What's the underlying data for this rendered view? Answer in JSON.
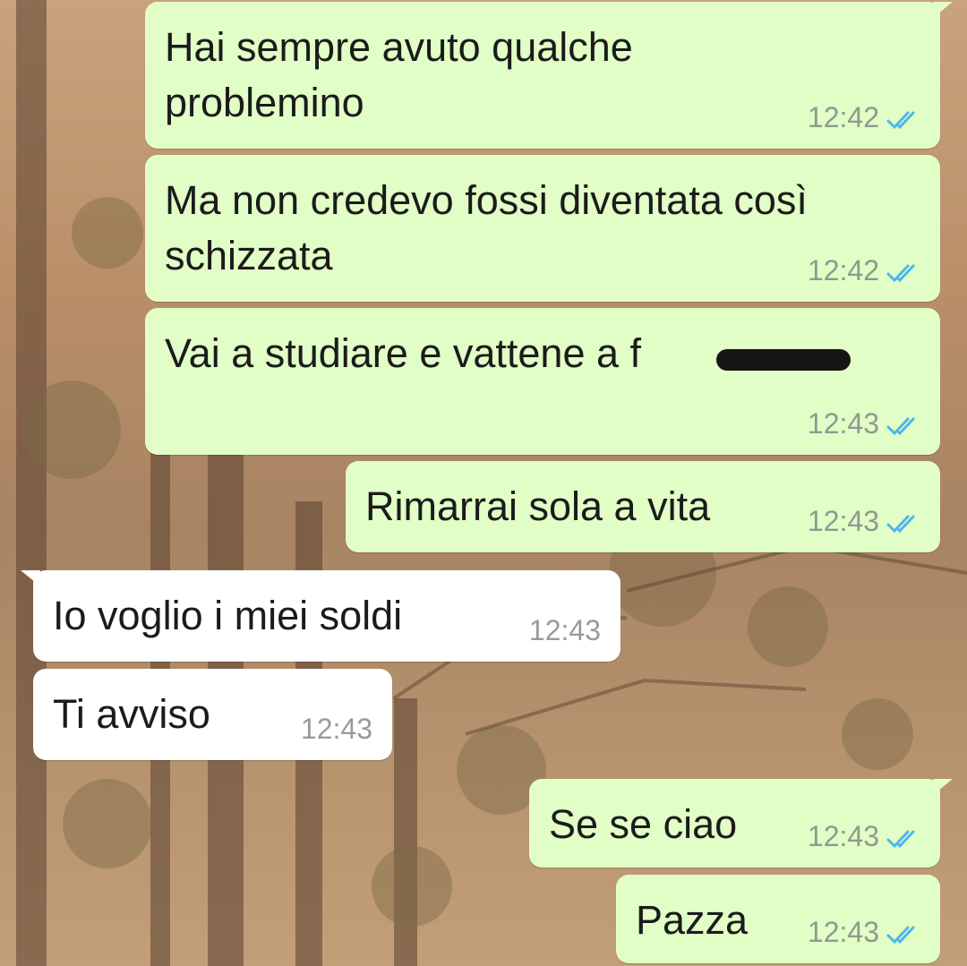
{
  "colors": {
    "outgoing_bubble": "#e1fec6",
    "incoming_bubble": "#ffffff",
    "read_ticks": "#4fb6ec",
    "timestamp": "#8d9a8f"
  },
  "icons": {
    "read_receipt": "double-check-icon"
  },
  "messages": [
    {
      "direction": "outgoing",
      "lines": [
        "Hai sempre avuto qualche",
        "problemino"
      ],
      "time": "12:42",
      "read": true
    },
    {
      "direction": "outgoing",
      "lines": [
        "Ma non credevo fossi diventata così",
        "schizzata"
      ],
      "time": "12:42",
      "read": true
    },
    {
      "direction": "outgoing",
      "lines": [
        "Vai a studiare e vattene a f"
      ],
      "redacted_suffix": true,
      "time": "12:43",
      "read": true
    },
    {
      "direction": "outgoing",
      "lines": [
        "Rimarrai sola a vita"
      ],
      "time": "12:43",
      "read": true
    },
    {
      "direction": "incoming",
      "lines": [
        "Io voglio i miei soldi"
      ],
      "time": "12:43"
    },
    {
      "direction": "incoming",
      "lines": [
        "Ti avviso"
      ],
      "time": "12:43"
    },
    {
      "direction": "outgoing",
      "lines": [
        "Se se ciao"
      ],
      "time": "12:43",
      "read": true
    },
    {
      "direction": "outgoing",
      "lines": [
        "Pazza"
      ],
      "time": "12:43",
      "read": true
    }
  ]
}
